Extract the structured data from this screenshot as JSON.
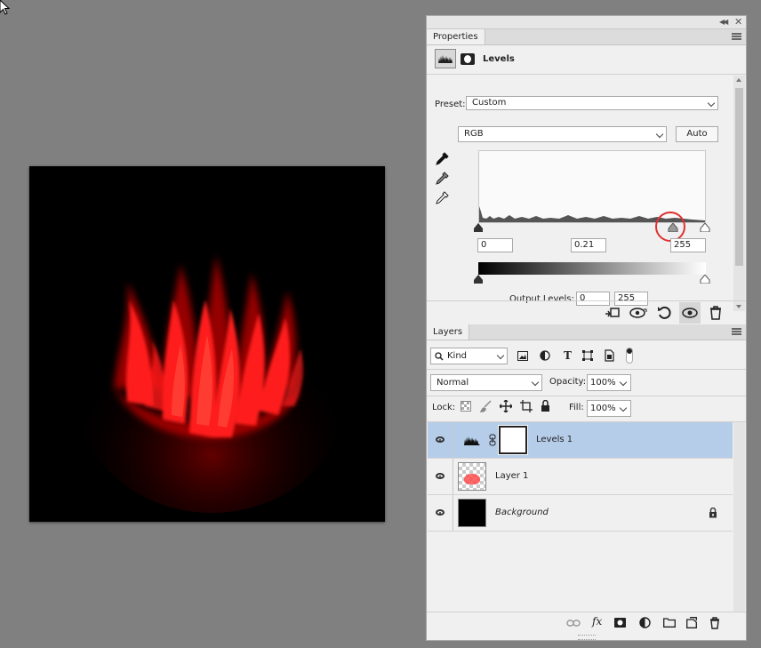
{
  "properties": {
    "tab_label": "Properties",
    "panel_title": "Levels",
    "preset_label": "Preset:",
    "preset_value": "Custom",
    "channel_value": "RGB",
    "auto_label": "Auto",
    "input_black": "0",
    "input_gamma": "0.21",
    "input_white": "255",
    "output_label": "Output Levels:",
    "output_black": "0",
    "output_white": "255"
  },
  "layers": {
    "tab_label": "Layers",
    "filter_kind": "Kind",
    "blend_mode": "Normal",
    "opacity_label": "Opacity:",
    "opacity_value": "100%",
    "lock_label": "Lock:",
    "fill_label": "Fill:",
    "fill_value": "100%",
    "items": [
      {
        "name": "Levels 1"
      },
      {
        "name": "Layer 1"
      },
      {
        "name": "Background"
      }
    ]
  },
  "colors": {
    "selected_row": "#b6cde9",
    "flame": "#ff1a1a",
    "highlight_circle": "#e03030"
  },
  "icons": [
    "cursor-arrow-icon",
    "collapse-double-chevron-icon",
    "close-icon",
    "panel-menu-icon",
    "histogram-icon",
    "mask-icon",
    "eyedropper-black-icon",
    "eyedropper-gray-icon",
    "eyedropper-white-icon",
    "clip-to-layer-icon",
    "view-previous-icon",
    "reset-icon",
    "visibility-icon",
    "trash-icon",
    "search-icon",
    "image-filter-icon",
    "adjustment-filter-icon",
    "type-filter-icon",
    "shape-filter-icon",
    "smart-object-filter-icon",
    "filter-toggle-icon",
    "lock-transparent-icon",
    "lock-paint-icon",
    "lock-position-icon",
    "lock-artboard-icon",
    "lock-all-icon",
    "link-icon",
    "fx-icon",
    "add-mask-icon",
    "new-adjustment-icon",
    "new-group-icon",
    "new-layer-icon",
    "lock-icon"
  ]
}
